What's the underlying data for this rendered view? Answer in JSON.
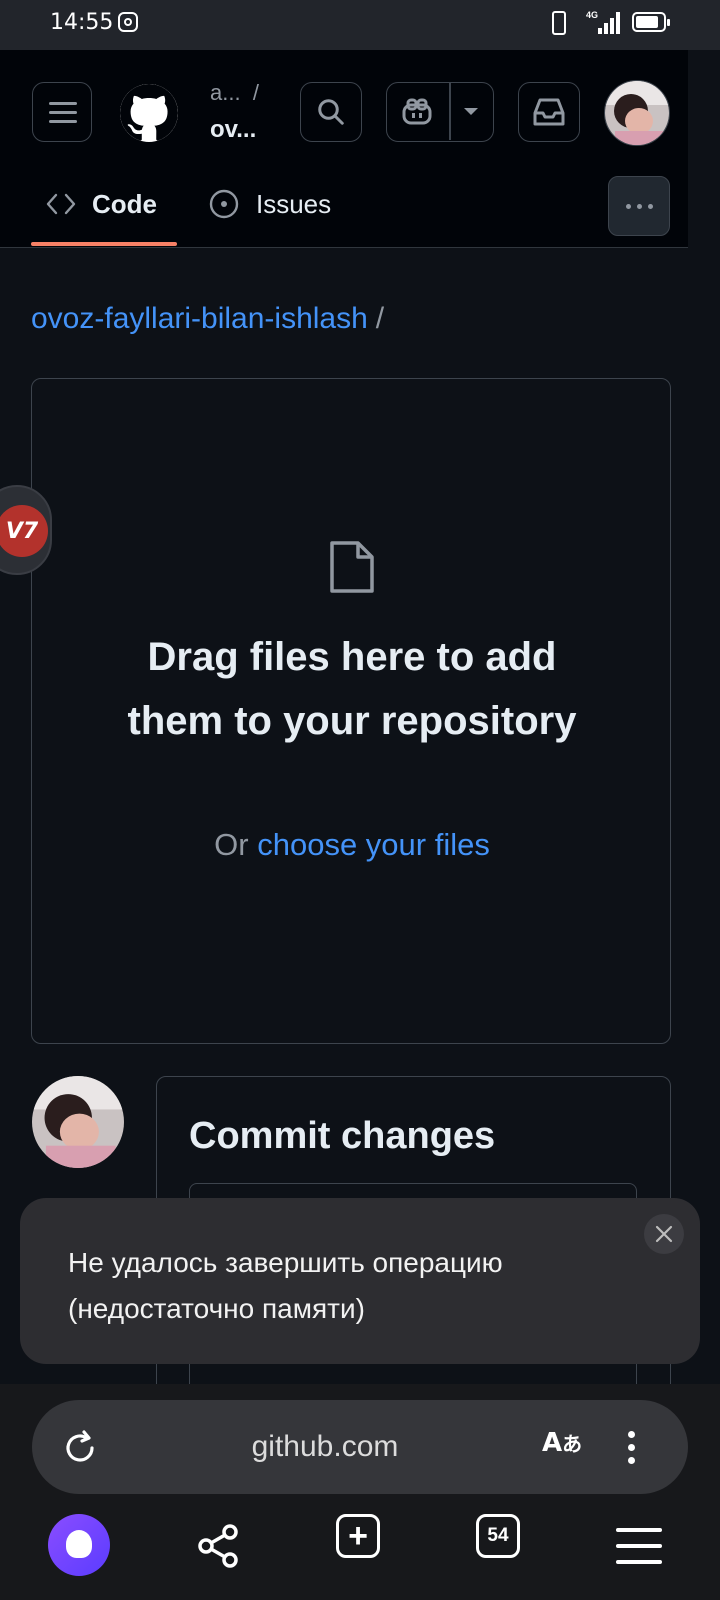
{
  "status_bar": {
    "time": "14:55",
    "network": "4G"
  },
  "header": {
    "owner": "a...",
    "separator": "/",
    "repo": "ov...",
    "tabs": [
      {
        "label": "Code",
        "icon": "code-icon",
        "selected": true
      },
      {
        "label": "Issues",
        "icon": "issue-opened-icon",
        "selected": false
      }
    ],
    "accent_color": "#f78166"
  },
  "breadcrumb": {
    "repo_link": "ovoz-fayllari-bilan-ishlash",
    "separator": "/"
  },
  "dropzone": {
    "title": "Drag files here to add them to your repository",
    "or_text": "Or",
    "choose_link": "choose your files",
    "icon": "file-icon"
  },
  "commit": {
    "title": "Commit changes"
  },
  "toast": {
    "message": "Не удалось завершить операцию (недостаточно памяти)"
  },
  "floating_badge": {
    "label": "V7"
  },
  "browser": {
    "url": "github.com",
    "tab_count": "54",
    "link_color": "#4493f8"
  }
}
